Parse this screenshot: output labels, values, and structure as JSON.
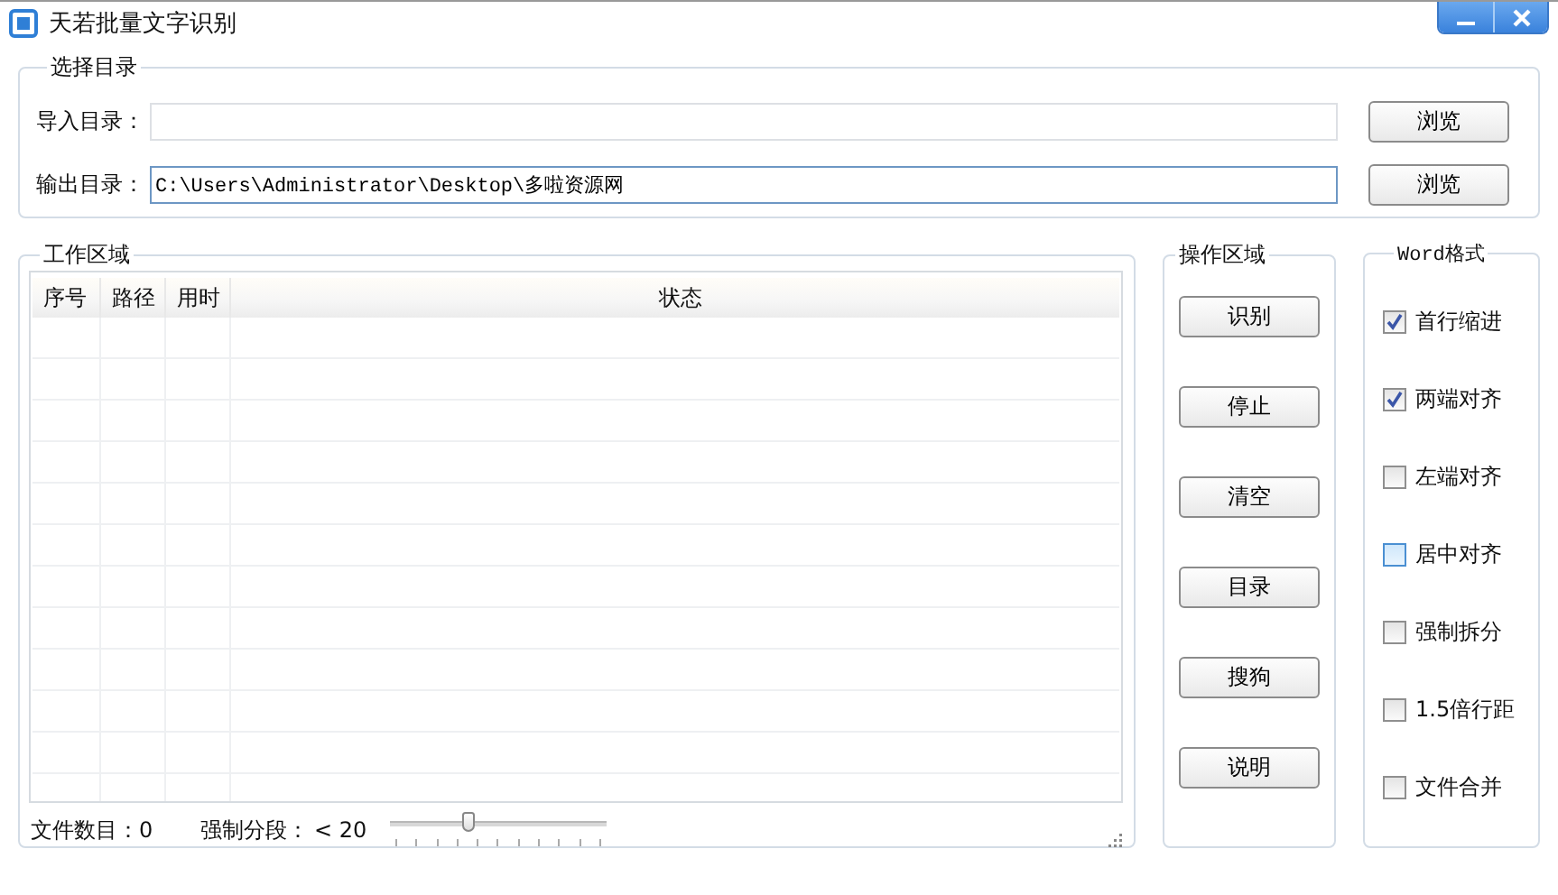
{
  "window": {
    "title": "天若批量文字识别"
  },
  "directories": {
    "title": "选择目录",
    "rows": [
      {
        "label": "导入目录：",
        "value": "",
        "focused": false,
        "button": "浏览"
      },
      {
        "label": "输出目录：",
        "value": "C:\\Users\\Administrator\\Desktop\\多啦资源网",
        "focused": true,
        "button": "浏览"
      }
    ]
  },
  "work_area": {
    "title": "工作区域",
    "table": {
      "columns": [
        "序号",
        "路径",
        "用时",
        "状态"
      ]
    },
    "file_count": "文件数目：0",
    "split_label": "强制分段：",
    "split_value": "< 20",
    "slider": {
      "level": 0.36
    }
  },
  "operations": {
    "title": "操作区域",
    "buttons": [
      "识别",
      "停止",
      "清空",
      "目录",
      "搜狗",
      "说明"
    ]
  },
  "word_format": {
    "title": "Word格式",
    "options": [
      {
        "label": "首行缩进",
        "checked": true,
        "hovered": false
      },
      {
        "label": "两端对齐",
        "checked": true,
        "hovered": false
      },
      {
        "label": "左端对齐",
        "checked": false,
        "hovered": false
      },
      {
        "label": "居中对齐",
        "checked": false,
        "hovered": true
      },
      {
        "label": "强制拆分",
        "checked": false,
        "hovered": false
      },
      {
        "label": "1.5倍行距",
        "checked": false,
        "hovered": false
      },
      {
        "label": "文件合并",
        "checked": false,
        "hovered": false
      }
    ]
  }
}
